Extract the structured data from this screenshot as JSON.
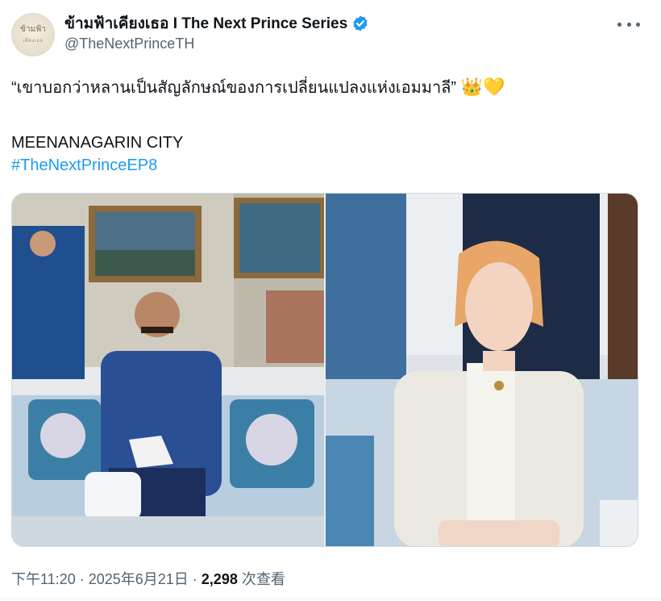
{
  "author": {
    "avatar_text": "ข้ามฟ้า",
    "avatar_subtext": "เคียงเธอ",
    "display_name": "ข้ามฟ้าเคียงเธอ I The Next Prince Series",
    "handle": "@TheNextPrinceTH",
    "verified_color": "#1d9bf0"
  },
  "tweet": {
    "quote_line": "“เขาบอกว่าหลานเป็นสัญลักษณ์ของการเปลี่ยนแปลงแห่งเอมมาลี”",
    "emojis": "👑💛",
    "location_line": "MEENANAGARIN CITY",
    "hashtag": "#TheNextPrinceEP8"
  },
  "meta": {
    "time": "下午11:20",
    "sep1": " · ",
    "date": "2025年6月21日",
    "sep2": " · ",
    "views_count": "2,298",
    "views_label": " 次查看"
  },
  "colors": {
    "link": "#1d9bf0",
    "secondary_text": "#536471",
    "primary_text": "#0f1419"
  }
}
